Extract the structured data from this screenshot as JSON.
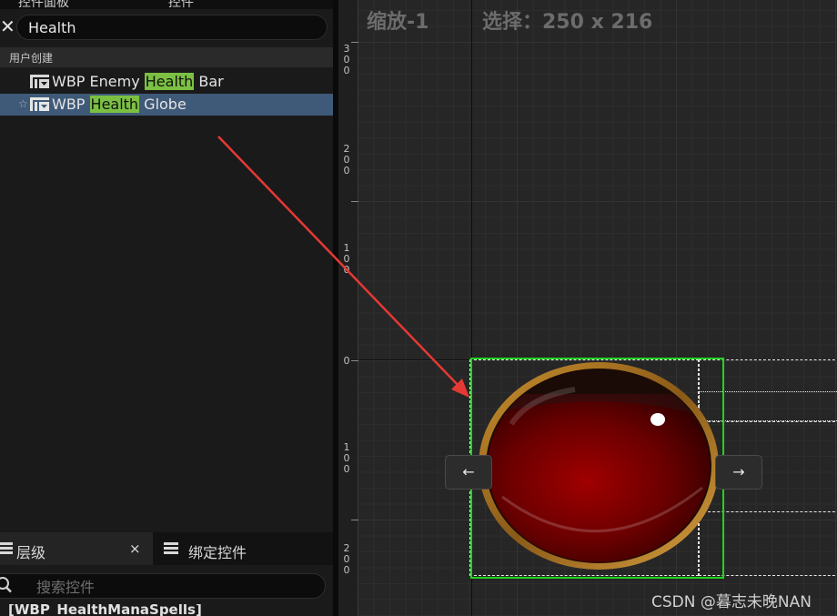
{
  "palette": {
    "top_tabs": [
      "控件面板",
      "控件"
    ],
    "search_value": "Health",
    "category": "用户创建",
    "results": [
      {
        "pre": "WBP Enemy ",
        "match": "Health",
        "post": " Bar",
        "selected": false,
        "favorite": false
      },
      {
        "pre": "WBP ",
        "match": "Health",
        "post": " Globe",
        "selected": true,
        "favorite": true
      }
    ]
  },
  "hierarchy": {
    "tab_label": "层级",
    "close_glyph": "×",
    "bind_tab_label": "绑定控件",
    "search_placeholder": "搜索控件",
    "root_node": "[WBP_HealthManaSpells]"
  },
  "designer": {
    "zoom_label": "缩放-1",
    "selection_label": "选择：250 x 216",
    "ruler": [
      {
        "text": "3\n0\n0"
      },
      {
        "text": "2\n0\n0"
      },
      {
        "text": "1\n0\n0"
      },
      {
        "text": "0"
      },
      {
        "text": "1\n0\n0"
      },
      {
        "text": "2\n0\n0"
      }
    ],
    "nav_left": "←",
    "nav_right": "→"
  },
  "watermark": "CSDN @暮志未晚NAN",
  "colors": {
    "highlight": "#7bc043",
    "selection_bg": "#3f5a78",
    "selection_border": "#1fd41f",
    "annotation_arrow": "#e53935"
  }
}
